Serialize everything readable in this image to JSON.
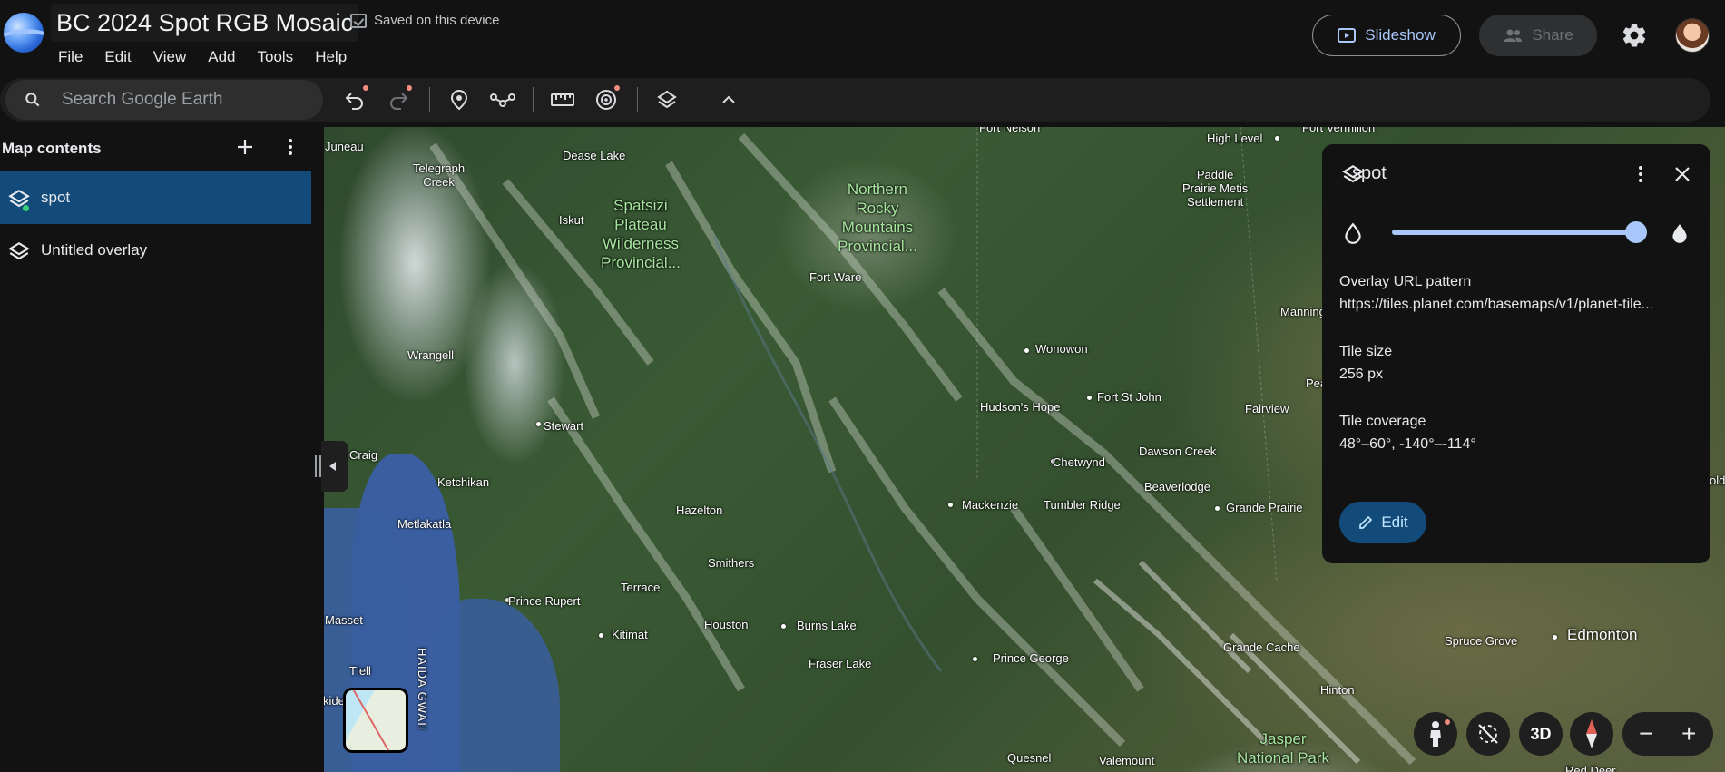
{
  "header": {
    "doc_title": "BC 2024 Spot RGB Mosaic",
    "saved_status": "Saved on this device",
    "slideshow_label": "Slideshow",
    "share_label": "Share"
  },
  "menu": [
    "File",
    "Edit",
    "View",
    "Add",
    "Tools",
    "Help"
  ],
  "search": {
    "placeholder": "Search Google Earth"
  },
  "toolbar": {
    "icons": [
      "undo-icon",
      "redo-icon",
      "placemark-icon",
      "path-icon",
      "ruler-icon",
      "capture-icon",
      "layers-icon",
      "chevron-up-icon"
    ]
  },
  "sidebar": {
    "title": "Map contents",
    "items": [
      {
        "label": "spot",
        "selected": true
      },
      {
        "label": "Untitled overlay",
        "selected": false
      }
    ]
  },
  "map_labels": {
    "juneau": "Juneau",
    "dease_lake": "Dease Lake",
    "telegraph_creek": "Telegraph\nCreek",
    "iskut": "Iskut",
    "spatsizi": "Spatsizi\nPlateau\nWilderness\nProvincial...",
    "northern_rocky": "Northern\nRocky\nMountains\nProvincial...",
    "fort_nelson": "Fort Nelson",
    "high_level": "High Level",
    "fort_vermilion": "Fort Vermilion",
    "paddle_prairie": "Paddle\nPrairie Metis\nSettlement",
    "fort_ware": "Fort Ware",
    "manning": "Manning",
    "wrangell": "Wrangell",
    "wonowon": "Wonowon",
    "hudsons_hope": "Hudson's Hope",
    "fort_st_john": "Fort St John",
    "fairview": "Fairview",
    "peace": "Pea",
    "stewart": "Stewart",
    "chetwynd": "Chetwynd",
    "dawson_creek": "Dawson Creek",
    "craig": "Craig",
    "ketchikan": "Ketchikan",
    "beaverlodge": "Beaverlodge",
    "gold": "old",
    "mackenzie": "Mackenzie",
    "tumbler_ridge": "Tumbler Ridge",
    "grande_prairie": "Grande Prairie",
    "hazelton": "Hazelton",
    "metlakatla": "Metlakatla",
    "smithers": "Smithers",
    "terrace": "Terrace",
    "prince_rupert": "Prince Rupert",
    "masset": "Masset",
    "houston": "Houston",
    "burns_lake": "Burns Lake",
    "kitimat": "Kitimat",
    "grande_cache": "Grande Cache",
    "spruce_grove": "Spruce Grove",
    "edmonton": "Edmonton",
    "fraser_lake": "Fraser Lake",
    "prince_george": "Prince George",
    "tlell": "Tlell",
    "haida_gwaii": "HAIDA GWAII",
    "hinton": "Hinton",
    "kide": "kide",
    "jasper": "Jasper\nNational Park",
    "quesnel": "Quesnel",
    "valemount": "Valemount",
    "red_deer": "Red Deer"
  },
  "panel": {
    "title": "spot",
    "opacity": 0.98,
    "url_label": "Overlay URL pattern",
    "url_value": "https://tiles.planet.com/basemaps/v1/planet-tile...",
    "tile_size_label": "Tile size",
    "tile_size_value": "256 px",
    "tile_coverage_label": "Tile coverage",
    "tile_coverage_value": "48°–60°, -140°–-114°",
    "edit_label": "Edit"
  },
  "map_controls": {
    "view_mode": "3D"
  },
  "colors": {
    "accent": "#a8c7fa",
    "selected_bg": "#124a7a",
    "panel_bg": "#121212",
    "app_bg": "#121212"
  }
}
